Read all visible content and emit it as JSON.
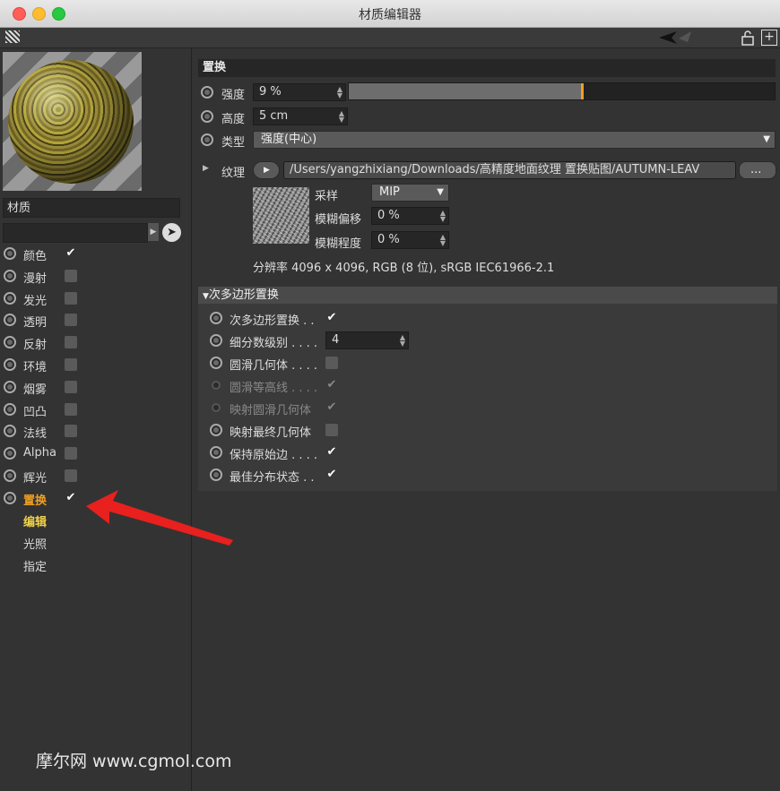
{
  "window": {
    "title": "材质编辑器"
  },
  "left": {
    "material_name": "材质",
    "channels": [
      {
        "label": "颜色",
        "checked": true
      },
      {
        "label": "漫射",
        "checked": false
      },
      {
        "label": "发光",
        "checked": false
      },
      {
        "label": "透明",
        "checked": false
      },
      {
        "label": "反射",
        "checked": false
      },
      {
        "label": "环境",
        "checked": false
      },
      {
        "label": "烟雾",
        "checked": false
      },
      {
        "label": "凹凸",
        "checked": false
      },
      {
        "label": "法线",
        "checked": false
      },
      {
        "label": "Alpha",
        "checked": false
      },
      {
        "label": "辉光",
        "checked": false
      },
      {
        "label": "置换",
        "checked": true,
        "active": true
      }
    ],
    "subitems": [
      "编辑",
      "光照",
      "指定"
    ],
    "check_glyph": "✔"
  },
  "main": {
    "section_title": "置换",
    "strength": {
      "label": "强度",
      "value": "9 %",
      "level_percent": 9
    },
    "height": {
      "label": "高度",
      "value": "5 cm"
    },
    "type": {
      "label": "类型",
      "value": "强度(中心)"
    },
    "texture": {
      "label": "纹理",
      "path": "/Users/yangzhixiang/Downloads/高精度地面纹理 置换贴图/AUTUMN-LEAV",
      "more_button": "...",
      "sampling_label": "采样",
      "sampling_value": "MIP",
      "blur_offset_label": "模糊偏移",
      "blur_offset_value": "0 %",
      "blur_scale_label": "模糊程度",
      "blur_scale_value": "0 %",
      "resolution": "分辨率 4096 x 4096, RGB (8 位), sRGB IEC61966-2.1"
    },
    "subpoly": {
      "title": "次多边形置换",
      "rows": [
        {
          "label": "次多边形置换 . .",
          "checked": true,
          "dim": false
        },
        {
          "label": "细分数级别 . . . .",
          "value": "4",
          "dim": false
        },
        {
          "label": "圆滑几何体 . . . .",
          "checked": false,
          "dim": false
        },
        {
          "label": "圆滑等高线 . . . .",
          "checked": true,
          "dim": true
        },
        {
          "label": "映射圆滑几何体",
          "checked": true,
          "dim": true
        },
        {
          "label": "映射最终几何体",
          "checked": false,
          "dim": false
        },
        {
          "label": "保持原始边 . . . .",
          "checked": true,
          "dim": false
        },
        {
          "label": "最佳分布状态 . .",
          "checked": true,
          "dim": false
        }
      ]
    }
  },
  "watermark": "摩尔网 www.cgmol.com",
  "colors": {
    "accent": "#f0a020",
    "active_sub": "#f2d24a",
    "arrow": "#e8201e"
  }
}
